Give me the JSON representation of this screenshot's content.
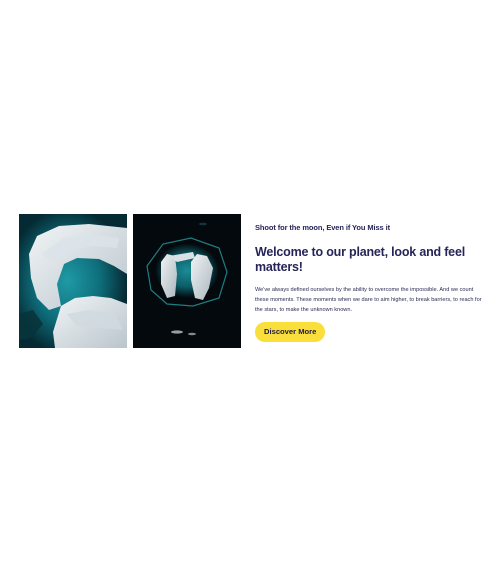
{
  "feature": {
    "eyebrow": "Shoot for the moon, Even if You Miss it",
    "headline": "Welcome to our planet, look and feel matters!",
    "body": "We've always defined ourselves by the ability to overcome the impossible. And we count these moments. These moments when we dare to aim higher, to break barriers, to reach for the stars, to make the unknown known.",
    "cta_label": "Discover More",
    "accent_color": "#f9de3c",
    "text_color": "#272458"
  },
  "gallery": {
    "images": [
      {
        "name": "iceberg-aerial-photo-1"
      },
      {
        "name": "iceberg-aerial-photo-2"
      }
    ]
  }
}
